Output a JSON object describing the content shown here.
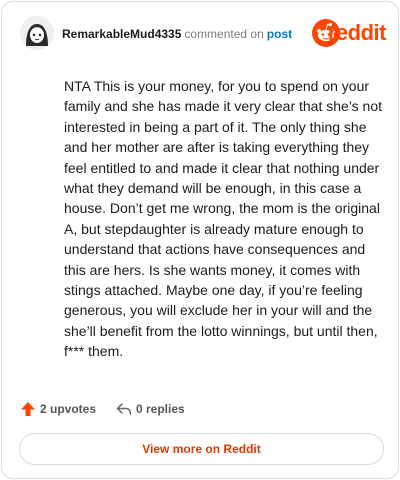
{
  "comment": {
    "author": "RemarkableMud4335",
    "action": "commented on",
    "post_link": "post",
    "body": "NTA This is your money, for you to spend on your family and she has made it very clear that she’s not interested in being a part of it. The only thing she and her mother are after is taking everything they feel entitled to and made it clear that nothing under what they demand will be enough, in this case a house. Don’t get me wrong, the mom is the original A, but stepdaughter is already mature enough to understand that actions have consequences and this are hers. Is she wants money, it comes with stings attached. Maybe one day, if you’re feeling generous, you will exclude her in your will and the she’ll benefit from the lotto winnings, but until then, f*** them."
  },
  "brand": {
    "wordmark": "reddit",
    "color": "#ff4500",
    "icon": "reddit-alien-icon"
  },
  "stats": {
    "upvotes_label": "2 upvotes",
    "replies_label": "0 replies",
    "upvote_icon": "upvote-arrow-icon",
    "reply_icon": "reply-arrow-icon"
  },
  "footer": {
    "view_more_label": "View more on Reddit"
  },
  "colors": {
    "accent": "#ff4500",
    "link": "#0079d3",
    "view_more_text": "#d93a00"
  }
}
